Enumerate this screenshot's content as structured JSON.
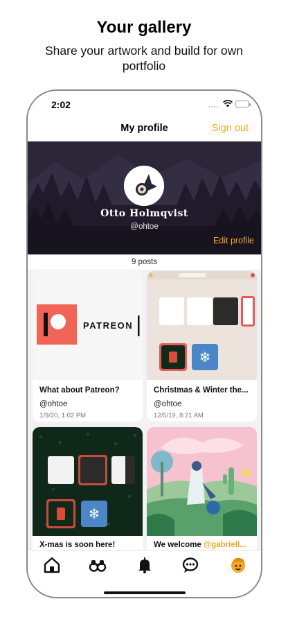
{
  "promo": {
    "title": "Your gallery",
    "subtitle": "Share your artwork and build for own portfolio"
  },
  "status_bar": {
    "time": "2:02"
  },
  "nav": {
    "title": "My profile",
    "sign_out": "Sign out"
  },
  "profile": {
    "display_name": "Otto Holmqvist",
    "handle": "@ohtoe",
    "edit_label": "Edit profile",
    "posts_count": "9 posts"
  },
  "posts": [
    {
      "title": "What about Patreon?",
      "author": "@ohtoe",
      "date": "1/9/20, 1:02 PM",
      "image_text": "PATREON"
    },
    {
      "title": "Christmas & Winter the...",
      "author": "@ohtoe",
      "date": "12/5/19, 8:21 AM"
    },
    {
      "title": "X-mas is soon here!"
    },
    {
      "title_prefix": "We welcome ",
      "title_mention": "@gabriell..."
    }
  ],
  "tabs": [
    {
      "icon": "home-icon"
    },
    {
      "icon": "binoculars-icon"
    },
    {
      "icon": "bell-icon"
    },
    {
      "icon": "chat-bubble-icon"
    },
    {
      "icon": "profile-face-icon"
    }
  ],
  "colors": {
    "accent": "#f5a623",
    "banner": "#2a2638",
    "patreon_red": "#f26556",
    "xmas_dark": "#0f2a18"
  }
}
